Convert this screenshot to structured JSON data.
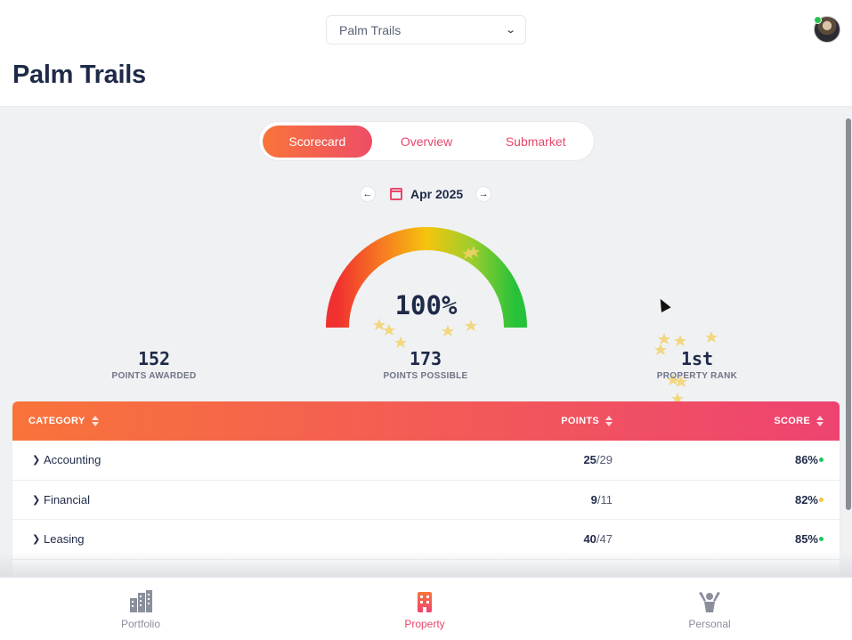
{
  "header": {
    "property_select": "Palm Trails",
    "page_title": "Palm Trails"
  },
  "tabs": [
    "Scorecard",
    "Overview",
    "Submarket"
  ],
  "date": "Apr 2025",
  "gauge": {
    "percent": 1.0,
    "label": "100%"
  },
  "stats": [
    {
      "value": "152",
      "label": "POINTS AWARDED"
    },
    {
      "value": "173",
      "label": "POINTS POSSIBLE"
    },
    {
      "value": "1st",
      "label": "PROPERTY RANK"
    }
  ],
  "table": {
    "headers": {
      "category": "CATEGORY",
      "points": "POINTS",
      "score": "SCORE"
    },
    "rows": [
      {
        "name": "Accounting",
        "earned": "25",
        "total": "/29",
        "score": "86%",
        "status_color": "#22c55e"
      },
      {
        "name": "Financial",
        "earned": "9",
        "total": "/11",
        "score": "82%",
        "status_color": "#f5c542"
      },
      {
        "name": "Leasing",
        "earned": "40",
        "total": "/47",
        "score": "85%",
        "status_color": "#22c55e"
      }
    ]
  },
  "bottom_nav": [
    {
      "label": "Portfolio",
      "icon": "buildings-icon"
    },
    {
      "label": "Property",
      "icon": "building-icon"
    },
    {
      "label": "Personal",
      "icon": "person-cheer-icon"
    }
  ],
  "colors": {
    "accent": "#ee4d66",
    "accent_orange": "#f8743a",
    "title": "#1f2a48"
  }
}
